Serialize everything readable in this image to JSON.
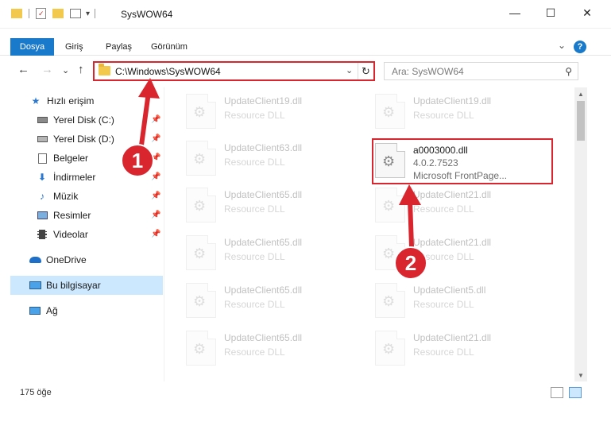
{
  "window": {
    "title": "SysWOW64",
    "minimize": "—",
    "maximize": "☐",
    "close": "✕"
  },
  "ribbon": {
    "tabs": [
      "Dosya",
      "Giriş",
      "Paylaş",
      "Görünüm"
    ],
    "expand": "⌄",
    "help": "?"
  },
  "address": {
    "path": "C:\\Windows\\SysWOW64",
    "dropdown": "⌄",
    "refresh": "↻"
  },
  "search": {
    "placeholder": "Ara: SysWOW64",
    "icon": "⚲"
  },
  "nav_buttons": {
    "back": "←",
    "forward": "→",
    "recent": "⌄",
    "up": "↑"
  },
  "sidebar": {
    "items": [
      {
        "label": "Hızlı erişim",
        "icon": "star-icon"
      },
      {
        "label": "Yerel Disk (C:)",
        "icon": "drive-icon"
      },
      {
        "label": "Yerel Disk (D:)",
        "icon": "drive-icon"
      },
      {
        "label": "Belgeler",
        "icon": "documents-icon"
      },
      {
        "label": "İndirmeler",
        "icon": "download-icon"
      },
      {
        "label": "Müzik",
        "icon": "music-icon"
      },
      {
        "label": "Resimler",
        "icon": "pictures-icon"
      },
      {
        "label": "Videolar",
        "icon": "videos-icon"
      },
      {
        "label": "OneDrive",
        "icon": "cloud-icon"
      },
      {
        "label": "Bu bilgisayar",
        "icon": "computer-icon"
      },
      {
        "label": "Ağ",
        "icon": "network-icon"
      }
    ]
  },
  "files": {
    "col1": [
      {
        "name": "UpdateClient19.dll",
        "desc": "Resource DLL"
      },
      {
        "name": "UpdateClient63.dll",
        "desc": "Resource DLL"
      },
      {
        "name": "UpdateClient65.dll",
        "desc": "Resource DLL"
      },
      {
        "name": "UpdateClient65.dll",
        "desc": "Resource DLL"
      },
      {
        "name": "UpdateClient65.dll",
        "desc": "Resource DLL"
      },
      {
        "name": "UpdateClient65.dll",
        "desc": "Resource DLL"
      }
    ],
    "col2": [
      {
        "name": "UpdateClient19.dll",
        "desc": "Resource DLL"
      },
      {
        "name": "UpdateClient21.dll",
        "desc": "Resource DLL"
      },
      {
        "name": "UpdateClient21.dll",
        "desc": "Resource DLL"
      },
      {
        "name": "UpdateClient5.dll",
        "desc": "Resource DLL"
      },
      {
        "name": "UpdateClient21.dll",
        "desc": "Resource DLL"
      }
    ],
    "highlighted": {
      "name": "a0003000.dll",
      "version": "4.0.2.7523",
      "desc": "Microsoft FrontPage..."
    }
  },
  "status": {
    "count": "175 öğe"
  },
  "annotations": {
    "step1": "1",
    "step2": "2",
    "color": "#d9252e"
  }
}
